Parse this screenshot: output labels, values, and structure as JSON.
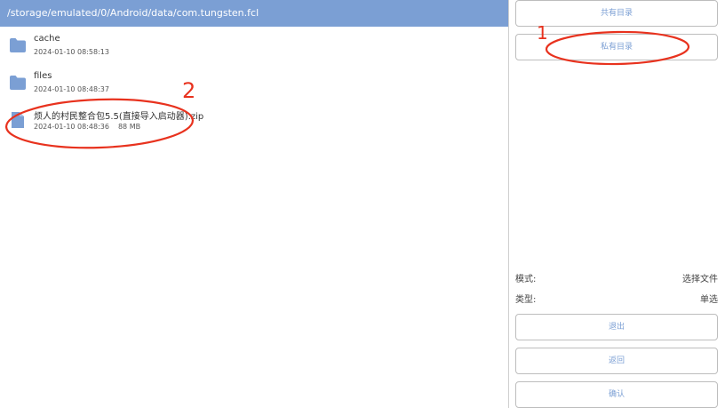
{
  "path": "/storage/emulated/0/Android/data/com.tungsten.fcl",
  "files": [
    {
      "icon": "folder-icon",
      "name": "cache",
      "date": "2024-01-10 08:58:13",
      "size": ""
    },
    {
      "icon": "folder-icon",
      "name": "files",
      "date": "2024-01-10 08:48:37",
      "size": ""
    },
    {
      "icon": "file-icon",
      "name": "烦人的村民整合包5.5(直接导入启动器).zip",
      "date": "2024-01-10 08:48:36",
      "size": "88 MB"
    }
  ],
  "right": {
    "shared_dir_label": "共有目录",
    "private_dir_label": "私有目录",
    "mode_key": "模式:",
    "mode_value": "选择文件",
    "type_key": "类型:",
    "type_value": "单选",
    "exit_label": "退出",
    "back_label": "返回",
    "confirm_label": "确认"
  },
  "annotations": {
    "mark_1": "1",
    "mark_2": "2"
  },
  "colors": {
    "accent": "#7b9fd4",
    "annotation": "#e8321e",
    "folder": "#7b9fd4"
  }
}
